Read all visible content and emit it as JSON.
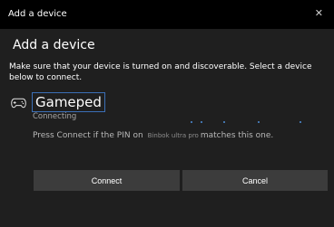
{
  "window": {
    "title": "Add a device",
    "close_glyph": "✕"
  },
  "dialog": {
    "heading": "Add a device",
    "instructions": "Make sure that your device is turned on and discoverable. Select a device below to connect."
  },
  "device": {
    "icon": "gamepad-icon",
    "name": "Gameped",
    "status": "Connecting",
    "pin_prefix": "Press Connect if the PIN on",
    "pin_device": "Binbok ultra pro",
    "pin_suffix": "matches this one."
  },
  "buttons": {
    "connect_label": "Connect",
    "cancel_label": "Cancel"
  },
  "colors": {
    "background": "#1f1f1f",
    "titlebar": "#000000",
    "accent": "#3b6fb6",
    "button": "#3c3c3c",
    "progress_dots": "#4f8fd8"
  }
}
